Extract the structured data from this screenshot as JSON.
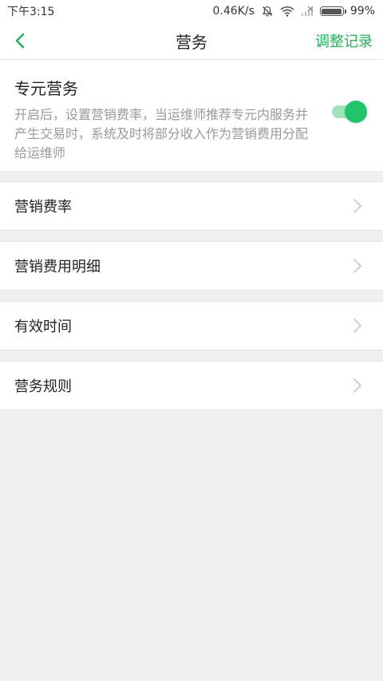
{
  "status_bar": {
    "time": "下午3:15",
    "network_speed": "0.46K/s",
    "battery_percent": "99%",
    "battery_level": 0.99,
    "icons": [
      "bell-muted-icon",
      "wifi-icon",
      "signal-icon",
      "battery-icon"
    ]
  },
  "nav": {
    "back_icon": "chevron-left-icon",
    "title": "营务",
    "action_label": "调整记录"
  },
  "toggle_section": {
    "title": "专元营务",
    "description": "开启后，设置营销费率，当运维师推荐专元内服务并产生交易时，系统及时将部分收入作为营销费用分配给运维师",
    "enabled": true
  },
  "menu": {
    "items": [
      {
        "label": "营销费率"
      },
      {
        "label": "营销费用明细"
      },
      {
        "label": "有效时间"
      },
      {
        "label": "营务规则"
      }
    ]
  },
  "colors": {
    "accent": "#22b05a",
    "switch_on": "#22c46a",
    "switch_track": "#9fe3b9",
    "background": "#efefef"
  }
}
